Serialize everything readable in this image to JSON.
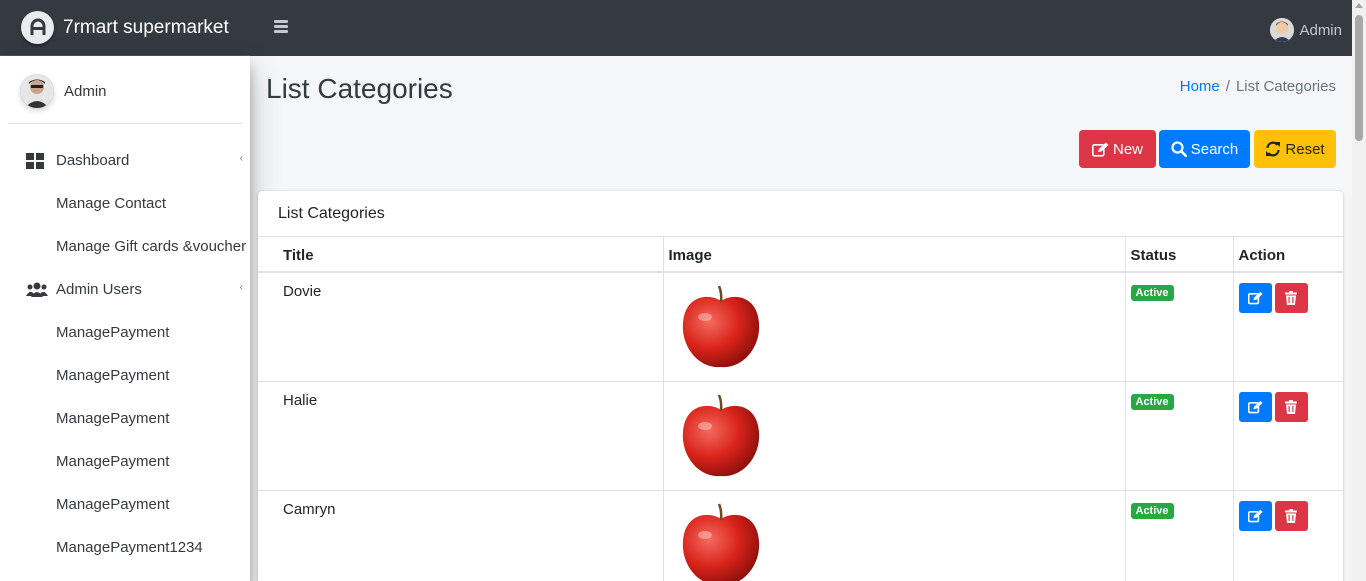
{
  "brand": {
    "name": "7rmart supermarket"
  },
  "sidebar": {
    "user_name": "Admin",
    "items": [
      {
        "label": "Dashboard",
        "icon": "dashboard-icon",
        "has_caret": true
      },
      {
        "label": "Manage Contact",
        "sub": true
      },
      {
        "label": "Manage Gift cards &voucher",
        "sub": true
      },
      {
        "label": "Admin Users",
        "icon": "users-icon",
        "has_caret": true
      },
      {
        "label": "ManagePayment",
        "sub": true
      },
      {
        "label": "ManagePayment",
        "sub": true
      },
      {
        "label": "ManagePayment",
        "sub": true
      },
      {
        "label": "ManagePayment",
        "sub": true
      },
      {
        "label": "ManagePayment",
        "sub": true
      },
      {
        "label": "ManagePayment1234",
        "sub": true
      }
    ]
  },
  "topbar": {
    "user_name": "Admin"
  },
  "page": {
    "title": "List Categories",
    "breadcrumb": {
      "home": "Home",
      "separator": "/",
      "current": "List Categories"
    }
  },
  "toolbar": {
    "new_label": "New",
    "search_label": "Search",
    "reset_label": "Reset"
  },
  "card": {
    "header": "List Categories",
    "columns": [
      "Title",
      "Image",
      "Status",
      "Action"
    ],
    "rows": [
      {
        "title": "Dovie",
        "status": "Active"
      },
      {
        "title": "Halie",
        "status": "Active"
      },
      {
        "title": "Camryn",
        "status": "Active"
      }
    ]
  },
  "colors": {
    "topbar": "#343a40",
    "primary": "#007bff",
    "danger": "#dc3545",
    "warning": "#ffc107",
    "success": "#28a745"
  }
}
